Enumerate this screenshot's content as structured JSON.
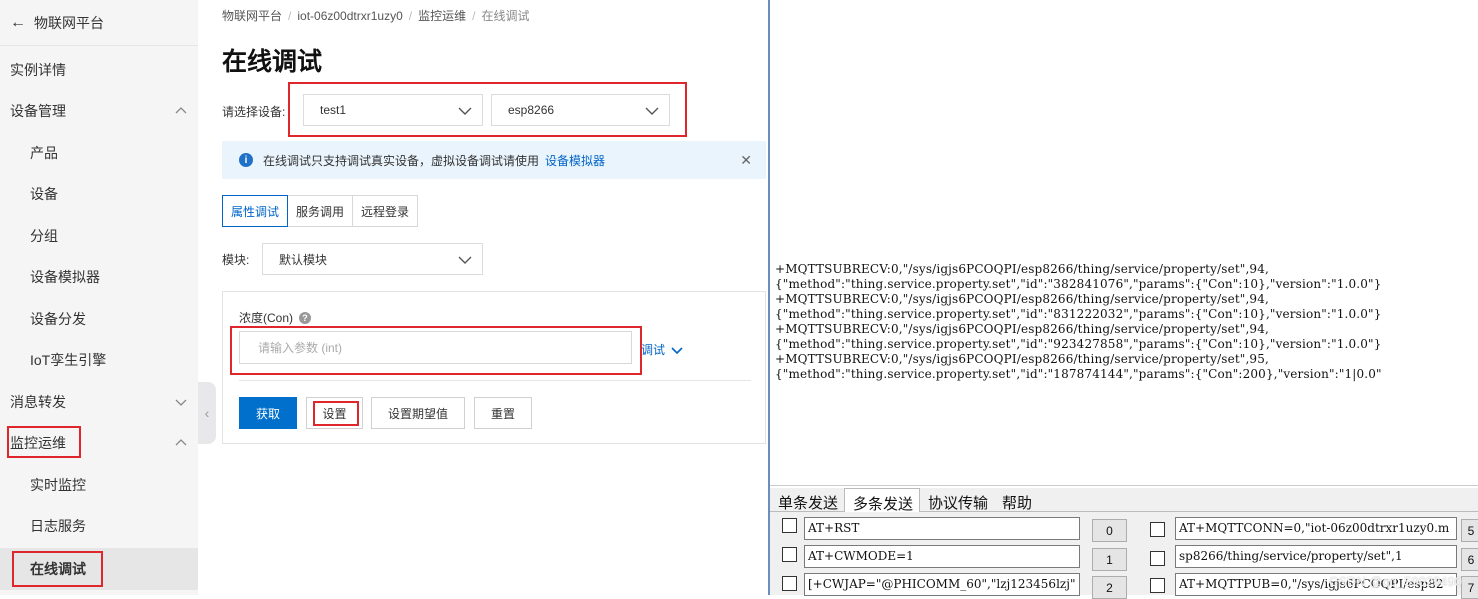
{
  "sidebar": {
    "back_label": "物联网平台",
    "items": [
      {
        "label": "实例详情"
      },
      {
        "label": "设备管理"
      },
      {
        "label": "产品"
      },
      {
        "label": "设备"
      },
      {
        "label": "分组"
      },
      {
        "label": "设备模拟器"
      },
      {
        "label": "设备分发"
      },
      {
        "label": "IoT孪生引擎"
      },
      {
        "label": "消息转发"
      },
      {
        "label": "监控运维"
      },
      {
        "label": "实时监控"
      },
      {
        "label": "日志服务"
      },
      {
        "label": "在线调试"
      }
    ]
  },
  "breadcrumb": {
    "items": [
      "物联网平台",
      "iot-06z00dtrxr1uzy0",
      "监控运维"
    ],
    "separator": "/",
    "current": "在线调试"
  },
  "page": {
    "title": "在线调试",
    "device_label": "请选择设备:",
    "product_select": "test1",
    "device_select": "esp8266",
    "notice_text": "在线调试只支持调试真实设备，虚拟设备调试请使用",
    "notice_link": "设备模拟器",
    "tabs": [
      "属性调试",
      "服务调用",
      "远程登录"
    ],
    "module_label": "模块:",
    "module_select": "默认模块",
    "field_label": "浓度(Con)",
    "field_placeholder": "请输入参数 (int)",
    "debug_link": "调试",
    "buttons": {
      "get": "获取",
      "set": "设置",
      "set_expected": "设置期望值",
      "reset": "重置"
    }
  },
  "terminal": {
    "output_lines": [
      "+MQTTSUBRECV:0,\"/sys/igjs6PCOQPI/esp8266/thing/service/property/set\",94,",
      "{\"method\":\"thing.service.property.set\",\"id\":\"382841076\",\"params\":{\"Con\":10},\"version\":\"1.0.0\"}",
      "+MQTTSUBRECV:0,\"/sys/igjs6PCOQPI/esp8266/thing/service/property/set\",94,",
      "{\"method\":\"thing.service.property.set\",\"id\":\"831222032\",\"params\":{\"Con\":10},\"version\":\"1.0.0\"}",
      "+MQTTSUBRECV:0,\"/sys/igjs6PCOQPI/esp8266/thing/service/property/set\",94,",
      "{\"method\":\"thing.service.property.set\",\"id\":\"923427858\",\"params\":{\"Con\":10},\"version\":\"1.0.0\"}",
      "+MQTTSUBRECV:0,\"/sys/igjs6PCOQPI/esp8266/thing/service/property/set\",95,",
      "{\"method\":\"thing.service.property.set\",\"id\":\"187874144\",\"params\":{\"Con\":200},\"version\":\"1|0.0\""
    ],
    "tabs": [
      "单条发送",
      "多条发送",
      "协议传输",
      "帮助"
    ],
    "commands_left": [
      {
        "cmd": "AT+RST",
        "num": "0"
      },
      {
        "cmd": "AT+CWMODE=1",
        "num": "1"
      },
      {
        "cmd": "[+CWJAP=\"@PHICOMM_60\",\"lzj123456lzj\"",
        "num": "2"
      }
    ],
    "commands_right": [
      {
        "cmd": "AT+MQTTCONN=0,\"iot-06z00dtrxr1uzy0.m",
        "num": "5"
      },
      {
        "cmd": "sp8266/thing/service/property/set\",1",
        "num": "6"
      },
      {
        "cmd": "AT+MQTTPUB=0,\"/sys/igjs6PCOQPI/esp82",
        "num": "7"
      }
    ],
    "watermark": "CSDN @qq_59029490"
  }
}
